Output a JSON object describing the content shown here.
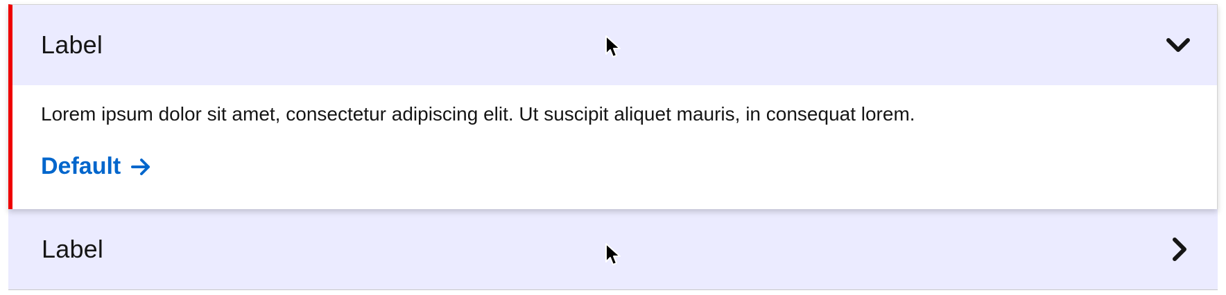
{
  "accordion": {
    "items": [
      {
        "label": "Label",
        "expanded": true,
        "body_text": "Lorem ipsum dolor sit amet, consectetur adipiscing elit. Ut suscipit aliquet mauris, in consequat lorem.",
        "link_label": "Default",
        "link_icon": "arrow-right-icon",
        "toggle_icon": "chevron-down-icon"
      },
      {
        "label": "Label",
        "expanded": false,
        "toggle_icon": "chevron-right-icon"
      }
    ]
  },
  "colors": {
    "header_bg": "#ebebff",
    "accent_border": "#ee0000",
    "link": "#0066cc",
    "text": "#151515"
  }
}
